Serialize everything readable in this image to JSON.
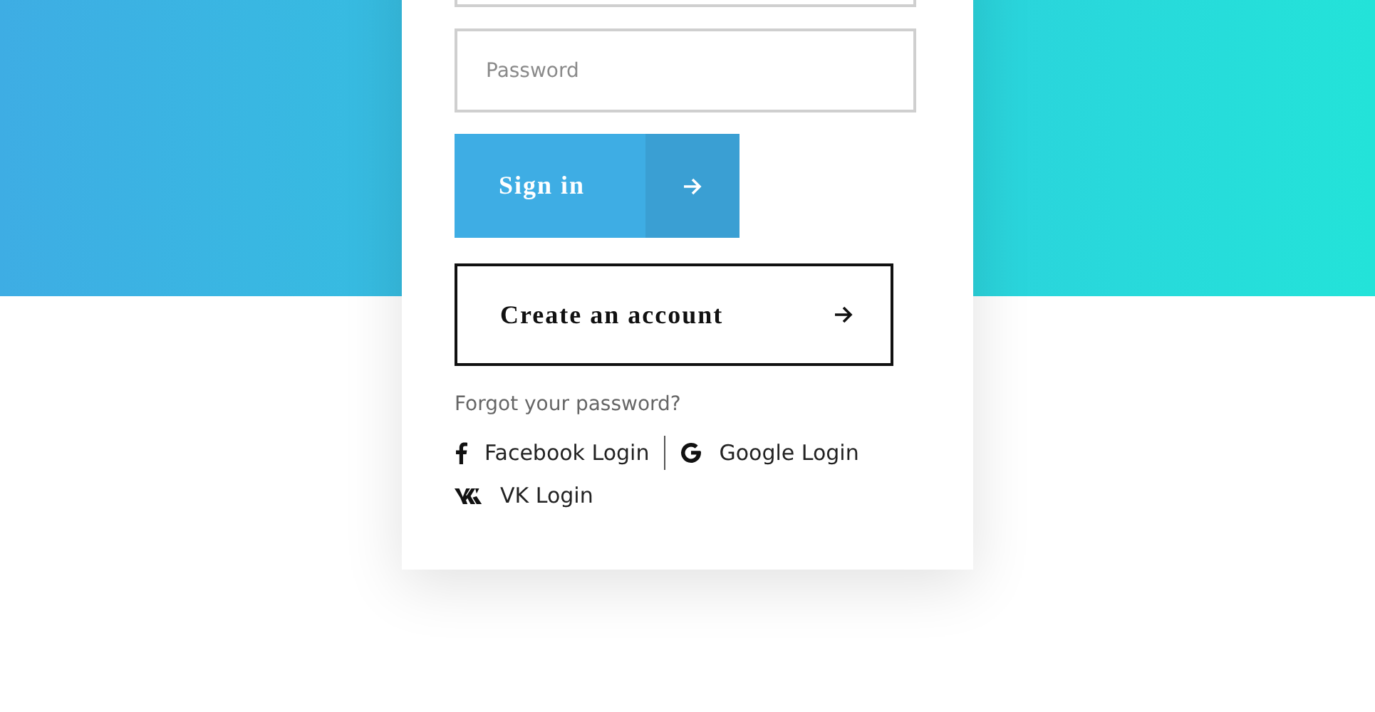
{
  "login_card": {
    "fields": [
      {
        "kind": "text"
      },
      {
        "kind": "password",
        "placeholder": "Password"
      }
    ],
    "sign_in_button": {
      "label": "Sign in"
    },
    "create_account_button": {
      "label": "Create an account"
    },
    "forgot_link": "Forgot your password?",
    "social_logins": [
      {
        "kind": "facebook",
        "label": "Facebook Login"
      },
      {
        "kind": "google",
        "label": "Google Login"
      },
      {
        "kind": "vk",
        "label": "VK Login"
      }
    ]
  }
}
